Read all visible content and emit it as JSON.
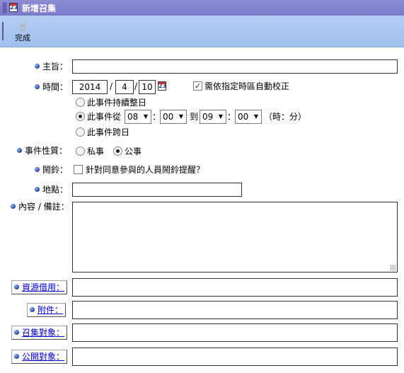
{
  "titlebar": {
    "calendar_icon_text": "23",
    "title": "新增召集"
  },
  "toolbar": {
    "done_icon": "hand-pointer-icon",
    "done_label": "完成"
  },
  "form": {
    "subject": {
      "label": "主旨：",
      "value": ""
    },
    "time": {
      "label": "時間：",
      "year": "2014",
      "month": "4",
      "day": "10",
      "sep1": "/",
      "sep2": "/",
      "calendar_icon_text": "23",
      "timezone_checked": true,
      "timezone_label": "需依指定時區自動校正",
      "option_allday": "此事件持續整日",
      "option_from": "此事件從",
      "from_hour": "08",
      "from_min": "00",
      "to_word": "到",
      "to_hour": "09",
      "to_min": "00",
      "colon1": "：",
      "colon2": "：",
      "unit_hint": "（時：分）",
      "option_multiday": "此事件跨日",
      "selected_option": "from"
    },
    "nature": {
      "label": "事件性質：",
      "private_label": "私事",
      "public_label": "公事",
      "selected": "public"
    },
    "reminder": {
      "label": "鬧鈴：",
      "checked": false,
      "text": "針對同意參與的人員鬧鈴提醒？"
    },
    "location": {
      "label": "地點：",
      "value": ""
    },
    "content": {
      "label": "內容 / 備註：",
      "value": ""
    },
    "resources": {
      "label": "資源借用：",
      "value": ""
    },
    "attachments": {
      "label": "附件：",
      "value": ""
    },
    "invitees": {
      "label": "召集對象：",
      "value": ""
    },
    "public_to": {
      "label": "公開對象：",
      "value": ""
    }
  }
}
